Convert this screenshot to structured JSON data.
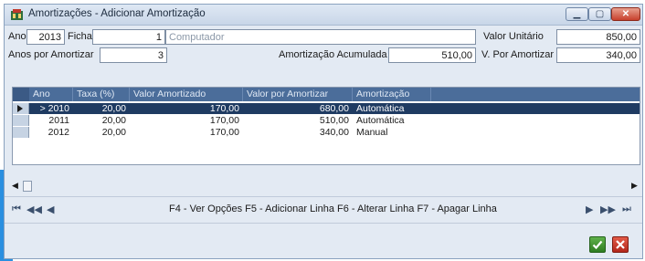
{
  "window": {
    "title": "Amortizações - Adicionar Amortização"
  },
  "form": {
    "ano_label": "Ano",
    "ano_value": "2013",
    "ficha_label": "Ficha",
    "ficha_value": "1",
    "descricao_value": "Computador",
    "valor_unitario_label": "Valor Unitário",
    "valor_unitario_value": "850,00",
    "anos_por_amortizar_label": "Anos por Amortizar",
    "anos_por_amortizar_value": "3",
    "amortizacao_acumulada_label": "Amortização Acumulada",
    "amortizacao_acumulada_value": "510,00",
    "v_por_amortizar_label": "V. Por Amortizar",
    "v_por_amortizar_value": "340,00"
  },
  "grid": {
    "columns": [
      "Ano",
      "Taxa (%)",
      "Valor Amortizado",
      "Valor por Amortizar",
      "Amortização"
    ],
    "rows": [
      {
        "ano": "> 2010",
        "taxa": "20,00",
        "valor_amortizado": "170,00",
        "valor_por_amortizar": "680,00",
        "amortizacao": "Automática"
      },
      {
        "ano": "2011",
        "taxa": "20,00",
        "valor_amortizado": "170,00",
        "valor_por_amortizar": "510,00",
        "amortizacao": "Automática"
      },
      {
        "ano": "2012",
        "taxa": "20,00",
        "valor_amortizado": "170,00",
        "valor_por_amortizar": "340,00",
        "amortizacao": "Manual"
      }
    ]
  },
  "navigation": {
    "first": "⏮",
    "prev_page": "◀◀",
    "prev": "◀",
    "next": "▶",
    "next_page": "▶▶",
    "last": "⏭",
    "hint": "F4 - Ver Opções  F5 - Adicionar Linha  F6 - Alterar Linha  F7 - Apagar Linha"
  },
  "buttons": {
    "ok": "✔",
    "cancel": "✖"
  },
  "colors": {
    "accent": "#2a8fe0",
    "grid_header": "#4b6d9a",
    "selected_row": "#1f3b62",
    "ok": "#3d8f2b",
    "cancel": "#c7301f"
  }
}
